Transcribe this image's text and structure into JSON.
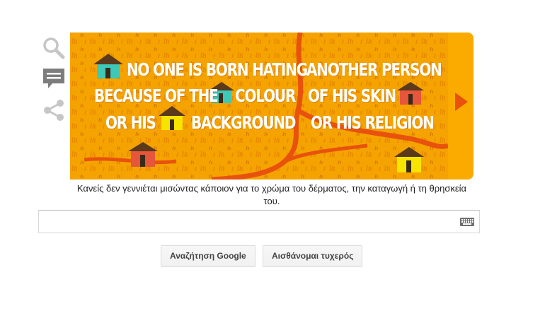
{
  "doodle": {
    "lines": [
      "NO ONE IS BORN HATING",
      "BECAUSE OF THE",
      "COLOUR",
      "OR HIS",
      "BACKGROUND",
      "ANOTHER PERSON",
      "OF HIS SKIN",
      "OR HIS RELIGION"
    ],
    "next_icon": "play-triangle-icon",
    "colors": {
      "background": "#f5a300",
      "road": "#e8520d",
      "text": "#ffffff",
      "panel": "#fbab00"
    }
  },
  "side_icons": [
    "search-icon",
    "speech-bubble-icon",
    "share-icon"
  ],
  "caption": "Κανείς δεν γεννιέται μισώντας κάποιον για το χρώμα του δέρματος, την καταγωγή ή τη θρησκεία του.",
  "search": {
    "value": "",
    "keyboard_icon": "keyboard-icon"
  },
  "buttons": {
    "search": "Αναζήτηση Google",
    "lucky": "Αισθάνομαι τυχερός"
  }
}
